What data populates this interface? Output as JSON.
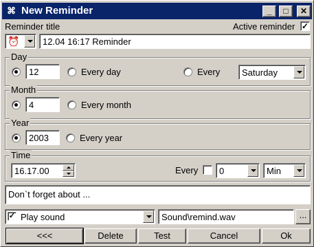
{
  "window": {
    "title": "New Reminder",
    "minimize_glyph": "_",
    "maximize_glyph": "□",
    "close_glyph": "✕"
  },
  "reminder": {
    "title_label": "Reminder title",
    "active_label": "Active reminder",
    "active_checked": true,
    "title_value": "12.04 16:17 Reminder",
    "icon_glyph": "⏰"
  },
  "day": {
    "group_label": "Day",
    "value": "12",
    "every_day_label": "Every day",
    "every_label": "Every",
    "weekday": "Saturday"
  },
  "month": {
    "group_label": "Month",
    "value": "4",
    "every_month_label": "Every month"
  },
  "year": {
    "group_label": "Year",
    "value": "2003",
    "every_year_label": "Every year"
  },
  "time": {
    "group_label": "Time",
    "value": "16.17.00",
    "every_label": "Every",
    "interval_value": "0",
    "unit": "Min"
  },
  "message": "Don`t forget about ...",
  "sound": {
    "play_label": "Play sound",
    "checked_glyph": "✓",
    "file": "Sound\\remind.wav",
    "browse_label": "..."
  },
  "buttons": {
    "back": "<<<",
    "delete": "Delete",
    "test": "Test",
    "cancel": "Cancel",
    "ok": "Ok"
  },
  "colors": {
    "titlebar": "#0a246a",
    "face": "#d4d0c8"
  }
}
